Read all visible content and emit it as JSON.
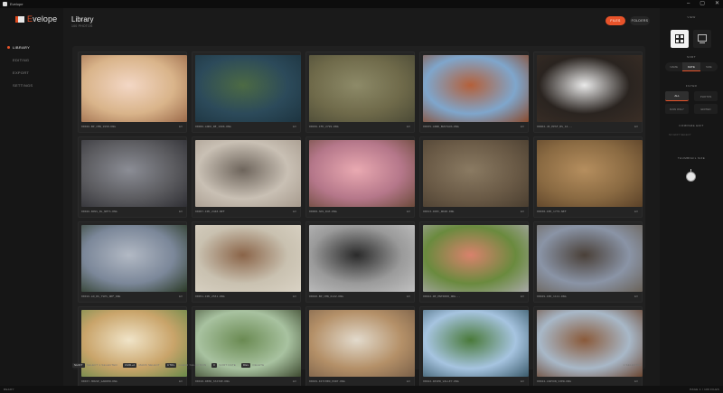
{
  "window": {
    "title": "Evelope",
    "minimize": "–",
    "maximize": "▢",
    "close": "✕"
  },
  "brand": {
    "mark": "E",
    "rest": "velope"
  },
  "nav": [
    {
      "label": "LIBRARY",
      "active": true
    },
    {
      "label": "EDITING",
      "active": false
    },
    {
      "label": "EXPORT",
      "active": false
    },
    {
      "label": "SETTINGS",
      "active": false
    }
  ],
  "library": {
    "title": "Library",
    "subtitle": "100 PHOTOS",
    "files_label": "FILES",
    "folders_label": "FOLDERS"
  },
  "thumbnails": [
    {
      "name": "00026-BP_CMN_1950.DNG",
      "ext": "EX",
      "colors": [
        "#d9b48a",
        "#f3d7c5",
        "#9c6a4a"
      ]
    },
    {
      "name": "00006-LNKO_RE_1996.DNG",
      "ext": "EX",
      "colors": [
        "#2c4a5a",
        "#4c6a44",
        "#1d3440"
      ]
    },
    {
      "name": "00036-IFD_2799.DNG",
      "ext": "EX",
      "colors": [
        "#6f6a4a",
        "#8d8a68",
        "#4b4a36"
      ]
    },
    {
      "name": "00035-LRND_BUSTAUS.DNG",
      "ext": "EX",
      "colors": [
        "#7fa6cc",
        "#b4603a",
        "#8a4a2c"
      ]
    },
    {
      "name": "00002-JK_EPSF_BS_12...",
      "ext": "EX",
      "colors": [
        "#2a2420",
        "#e9e9e9",
        "#3a2e26"
      ]
    },
    {
      "name": "00046-KNSS_RL_NETS.DNG",
      "ext": "EX",
      "colors": [
        "#5c5c60",
        "#8b8d95",
        "#2f2f34"
      ]
    },
    {
      "name": "00007-IPD_2448.NEF",
      "ext": "EX",
      "colors": [
        "#c9c0b4",
        "#6e655c",
        "#a69a8d"
      ]
    },
    {
      "name": "00008-SDS_R43.DNG",
      "ext": "EX",
      "colors": [
        "#b5778a",
        "#e9a9b1",
        "#6b4a3a"
      ]
    },
    {
      "name": "00013-IDPC_RD48.DNG",
      "ext": "EX",
      "colors": [
        "#6a5a46",
        "#8a7a62",
        "#4a3e30"
      ]
    },
    {
      "name": "00038-IPD_1779.NEF",
      "ext": "EX",
      "colors": [
        "#8a6a42",
        "#b58e5e",
        "#5a4128"
      ]
    },
    {
      "name": "00016-LN_RS_YSPS_NPF_DNG",
      "ext": "EX",
      "colors": [
        "#7b8799",
        "#b2b9c4",
        "#2b3a26"
      ]
    },
    {
      "name": "00051-IPD_2551.DNG",
      "ext": "EX",
      "colors": [
        "#c9c1b0",
        "#8a6448",
        "#d9d2c4"
      ]
    },
    {
      "name": "00020-BP_CMN_6122.DNG",
      "ext": "EX",
      "colors": [
        "#9a9a9a",
        "#2a2a2a",
        "#c0c0c0"
      ]
    },
    {
      "name": "00022-RE_PNT0008_DNG...",
      "ext": "EX",
      "colors": [
        "#6a8a3e",
        "#d9826c",
        "#a8a8a8"
      ]
    },
    {
      "name": "00049-IPD_1111.DNG",
      "ext": "EX",
      "colors": [
        "#8a94a6",
        "#4a4038",
        "#6a6258"
      ]
    },
    {
      "name": "00037-HOUSE_GARDEN.DNG",
      "ext": "EX",
      "colors": [
        "#c9a46a",
        "#f0e4c8",
        "#6a8a4a"
      ]
    },
    {
      "name": "00018-DEER_STATUE.DNG",
      "ext": "EX",
      "colors": [
        "#a8c2a0",
        "#6a8a52",
        "#3e4a30"
      ]
    },
    {
      "name": "00029-KITCHEN_PORT.DNG",
      "ext": "EX",
      "colors": [
        "#b49068",
        "#e2dacc",
        "#7a6048"
      ]
    },
    {
      "name": "00042-RIVER_VALLEY.DNG",
      "ext": "EX",
      "colors": [
        "#a6c4e0",
        "#4a7a3a",
        "#3a5a6a"
      ]
    },
    {
      "name": "00044-CANYON_VIEW.DNG",
      "ext": "EX",
      "colors": [
        "#a8b8c8",
        "#8a5a3a",
        "#6a4530"
      ]
    }
  ],
  "status": {
    "select_key": "SHIFT",
    "select_text": "SELECT 1 SELECTED",
    "multi_key": "CMD+A",
    "multi_text": "MARK SELECT",
    "clear_key": "CTRL",
    "clear_text": "CLEAR SELECTION",
    "sort_key": "F",
    "sort_text": "SORT DATE",
    "delete_key": "DEL",
    "delete_text": "DELETE",
    "count": "1 SELECTED"
  },
  "panel": {
    "view_header": "VIEW",
    "grid_icon": "grid-icon",
    "single_icon": "single-view-icon",
    "sort_header": "SORT",
    "sort_options": [
      "NAME",
      "DATE",
      "SIZE"
    ],
    "sort_active": 1,
    "filter_header": "FILTER",
    "filter_options": [
      "ALL",
      "PHOTOS",
      "RAW ONLY",
      "EDITED"
    ],
    "filter_active": 0,
    "dimension_header": "COMPARE EDIT",
    "dimension_note": "NO EDIT SELECT",
    "thumb_header": "THUMBNAIL SIZE"
  },
  "bottom": {
    "left": "READY",
    "right": "PAGE 1 / 100 FILES"
  },
  "colors": {
    "accent": "#e8532a"
  }
}
